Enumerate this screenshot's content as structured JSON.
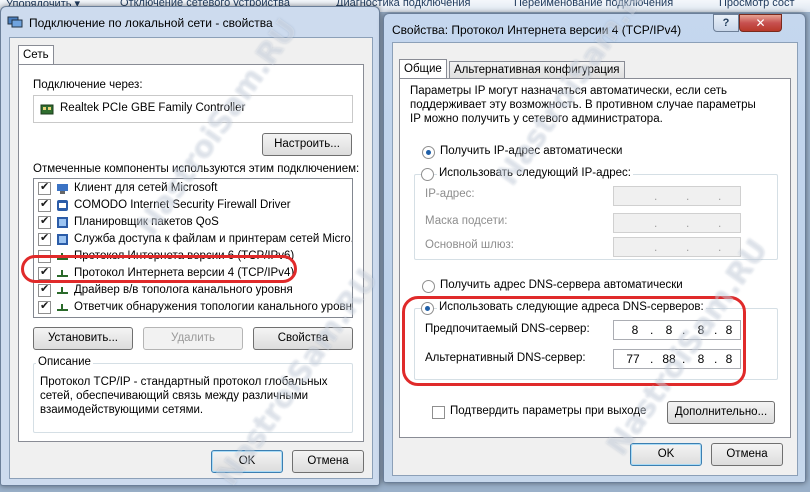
{
  "topbar": {
    "items": [
      "Упорядочить ▾",
      "Отключение сетевого устройства",
      "Диагностика подключения",
      "Переименование подключения",
      "Просмотр сост"
    ]
  },
  "left_window": {
    "title": "Подключение по локальной сети - свойства",
    "tab": "Сеть",
    "connect_via_label": "Подключение через:",
    "adapter_name": "Realtek PCIe GBE Family Controller",
    "configure_button": "Настроить...",
    "components_label": "Отмеченные компоненты используются этим подключением:",
    "components": [
      {
        "label": "Клиент для сетей Microsoft",
        "checked": true,
        "icon": "network-client-icon"
      },
      {
        "label": "COMODO Internet Security Firewall Driver",
        "checked": true,
        "icon": "firewall-driver-icon"
      },
      {
        "label": "Планировщик пакетов QoS",
        "checked": true,
        "icon": "qos-scheduler-icon"
      },
      {
        "label": "Служба доступа к файлам и принтерам сетей Micro...",
        "checked": true,
        "icon": "file-sharing-icon"
      },
      {
        "label": "Протокол Интернета версии 6 (TCP/IPv6)",
        "checked": false,
        "icon": "protocol-icon"
      },
      {
        "label": "Протокол Интернета версии 4 (TCP/IPv4)",
        "checked": true,
        "icon": "protocol-icon"
      },
      {
        "label": "Драйвер в/в тополога канального уровня",
        "checked": true,
        "icon": "protocol-icon"
      },
      {
        "label": "Ответчик обнаружения топологии канального уровня",
        "checked": true,
        "icon": "protocol-icon"
      }
    ],
    "install_button": "Установить...",
    "remove_button": "Удалить",
    "properties_button": "Свойства",
    "description_legend": "Описание",
    "description_text": [
      "Протокол TCP/IP - стандартный протокол глобальных",
      "сетей, обеспечивающий связь между различными",
      "взаимодействующими сетями."
    ],
    "ok_button": "OK",
    "cancel_button": "Отмена"
  },
  "right_window": {
    "title": "Свойства: Протокол Интернета версии 4 (TCP/IPv4)",
    "help_glyph": "?",
    "close_glyph": "✕",
    "tabs": [
      "Общие",
      "Альтернативная конфигурация"
    ],
    "info_text": [
      "Параметры IP могут назначаться автоматически, если сеть",
      "поддерживает эту возможность. В противном случае параметры",
      "IP можно получить у сетевого администратора."
    ],
    "ip_auto_label": "Получить IP-адрес автоматически",
    "ip_manual_label": "Использовать следующий IP-адрес:",
    "ip_address_label": "IP-адрес:",
    "subnet_label": "Маска подсети:",
    "gateway_label": "Основной шлюз:",
    "dns_auto_label": "Получить адрес DNS-сервера автоматически",
    "dns_manual_label": "Использовать следующие адреса DNS-серверов:",
    "preferred_dns_label": "Предпочитаемый DNS-сервер:",
    "preferred_dns": [
      "8",
      "8",
      "8",
      "8"
    ],
    "alternate_dns_label": "Альтернативный DNS-сервер:",
    "alternate_dns": [
      "77",
      "88",
      "8",
      "8"
    ],
    "validate_label": "Подтвердить параметры при выходе",
    "advanced_button": "Дополнительно...",
    "ok_button": "OK",
    "cancel_button": "Отмена"
  },
  "watermark": "NastroiSam.RU",
  "colors": {
    "highlight": "#e02a2a",
    "window_frame": "#c5d7ee",
    "selected_radio": "#1f5fa8"
  }
}
